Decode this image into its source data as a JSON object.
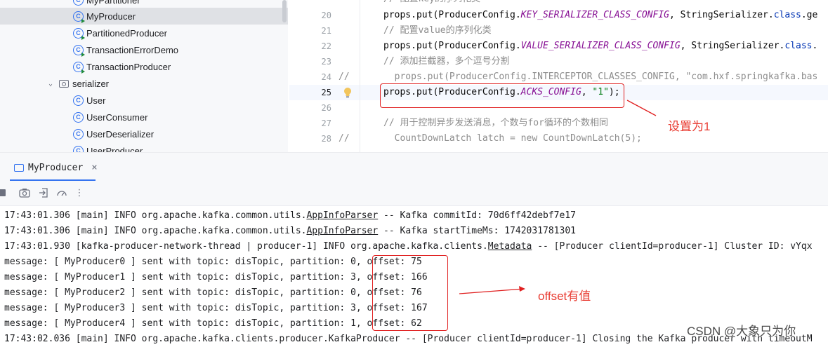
{
  "project_tree": {
    "items": [
      {
        "label": "MyPartitioner",
        "type": "class"
      },
      {
        "label": "MyProducer",
        "type": "class-run",
        "selected": true
      },
      {
        "label": "PartitionedProducer",
        "type": "class-run"
      },
      {
        "label": "TransactionErrorDemo",
        "type": "class-run"
      },
      {
        "label": "TransactionProducer",
        "type": "class-run"
      },
      {
        "label": "serializer",
        "type": "package"
      },
      {
        "label": "User",
        "type": "class"
      },
      {
        "label": "UserConsumer",
        "type": "class"
      },
      {
        "label": "UserDeserializer",
        "type": "class"
      },
      {
        "label": "UserProducer",
        "type": "class"
      }
    ]
  },
  "editor": {
    "lines": [
      {
        "num": "20",
        "comment_prefix": "",
        "parts": [
          [
            "plain",
            "props.put(ProducerConfig."
          ],
          [
            "konst",
            "KEY_SERIALIZER_CLASS_CONFIG"
          ],
          [
            "plain",
            ", StringSerializer."
          ],
          [
            "kw",
            "class"
          ],
          [
            "plain",
            ".ge"
          ]
        ]
      },
      {
        "num": "21",
        "comment_prefix": "",
        "parts": [
          [
            "comment",
            "// 配置value的序列化类"
          ]
        ]
      },
      {
        "num": "22",
        "comment_prefix": "",
        "parts": [
          [
            "plain",
            "props.put(ProducerConfig."
          ],
          [
            "konst",
            "VALUE_SERIALIZER_CLASS_CONFIG"
          ],
          [
            "plain",
            ", StringSerializer."
          ],
          [
            "kw",
            "class"
          ],
          [
            "plain",
            "."
          ]
        ]
      },
      {
        "num": "23",
        "comment_prefix": "",
        "parts": [
          [
            "comment",
            "// 添加拦截器，多个逗号分割"
          ]
        ]
      },
      {
        "num": "24",
        "comment_prefix": "//",
        "parts": [
          [
            "comment",
            "  props.put(ProducerConfig.INTERCEPTOR_CLASSES_CONFIG, \"com.hxf.springkafka.bas"
          ]
        ]
      },
      {
        "num": "25",
        "comment_prefix": "",
        "parts": [
          [
            "plain",
            "props.put(ProducerConfig."
          ],
          [
            "konst",
            "ACKS_CONFIG"
          ],
          [
            "plain",
            ", "
          ],
          [
            "str",
            "\"1\""
          ],
          [
            "plain",
            ");"
          ]
        ]
      },
      {
        "num": "26",
        "comment_prefix": "",
        "parts": []
      },
      {
        "num": "27",
        "comment_prefix": "",
        "parts": [
          [
            "comment",
            "// 用于控制异步发送消息，个数与for循环的个数相同"
          ]
        ]
      },
      {
        "num": "28",
        "comment_prefix": "//",
        "parts": [
          [
            "comment",
            "  CountDownLatch latch = new CountDownLatch(5);"
          ]
        ]
      }
    ],
    "top_partial_comment": "// 配置key的序列化类",
    "annotation": "设置为1"
  },
  "run_panel": {
    "tab_label": "MyProducer",
    "close_label": "×"
  },
  "console": {
    "lines": [
      {
        "pre": "17:43:01.306 [main] INFO org.apache.kafka.common.utils.",
        "link": "AppInfoParser",
        "post": " -- Kafka commitId: 70d6ff42debf7e17"
      },
      {
        "pre": "17:43:01.306 [main] INFO org.apache.kafka.common.utils.",
        "link": "AppInfoParser",
        "post": " -- Kafka startTimeMs: 1742031781301"
      },
      {
        "pre": "17:43:01.930 [kafka-producer-network-thread | producer-1] INFO org.apache.kafka.clients.",
        "link": "Metadata",
        "post": " -- [Producer clientId=producer-1] Cluster ID: vYqx"
      },
      {
        "pre": "message: [ MyProducer0 ] sent with topic: disTopic, partition: 0, offset: 75",
        "link": "",
        "post": ""
      },
      {
        "pre": "message: [ MyProducer1 ] sent with topic: disTopic, partition: 3, offset: 166",
        "link": "",
        "post": ""
      },
      {
        "pre": "message: [ MyProducer2 ] sent with topic: disTopic, partition: 0, offset: 76",
        "link": "",
        "post": ""
      },
      {
        "pre": "message: [ MyProducer3 ] sent with topic: disTopic, partition: 3, offset: 167",
        "link": "",
        "post": ""
      },
      {
        "pre": "message: [ MyProducer4 ] sent with topic: disTopic, partition: 1, offset: 62",
        "link": "",
        "post": ""
      },
      {
        "pre": "17:43:02.036 [main] INFO org.apache.kafka.clients.producer.KafkaProducer -- [Producer clientId=producer-1] Closing the Kafka producer with timeoutM",
        "link": "",
        "post": ""
      }
    ],
    "annotation": "offset有值"
  },
  "watermark": "CSDN @大象只为你"
}
